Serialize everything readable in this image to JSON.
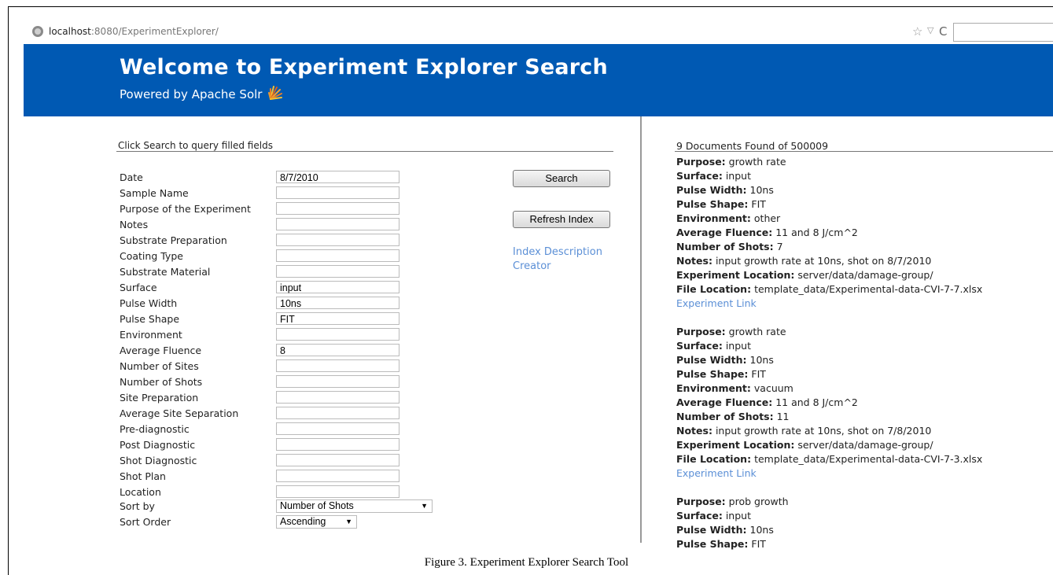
{
  "browser": {
    "url_host": "localhost",
    "url_rest": ":8080/ExperimentExplorer/"
  },
  "header": {
    "title": "Welcome to Experiment Explorer Search",
    "subtitle": "Powered by Apache Solr",
    "bg_color": "#0059b3"
  },
  "form": {
    "hint": "Click Search to query filled fields",
    "fields": [
      {
        "label": "Date",
        "value": "8/7/2010"
      },
      {
        "label": "Sample Name",
        "value": ""
      },
      {
        "label": "Purpose of the Experiment",
        "value": ""
      },
      {
        "label": "Notes",
        "value": ""
      },
      {
        "label": "Substrate Preparation",
        "value": ""
      },
      {
        "label": "Coating Type",
        "value": ""
      },
      {
        "label": "Substrate Material",
        "value": ""
      },
      {
        "label": "Surface",
        "value": "input"
      },
      {
        "label": "Pulse Width",
        "value": "10ns"
      },
      {
        "label": "Pulse Shape",
        "value": "FIT"
      },
      {
        "label": "Environment",
        "value": ""
      },
      {
        "label": "Average Fluence",
        "value": "8"
      },
      {
        "label": "Number of Sites",
        "value": ""
      },
      {
        "label": "Number of Shots",
        "value": ""
      },
      {
        "label": "Site Preparation",
        "value": ""
      },
      {
        "label": "Average Site Separation",
        "value": ""
      },
      {
        "label": "Pre-diagnostic",
        "value": ""
      },
      {
        "label": "Post Diagnostic",
        "value": ""
      },
      {
        "label": "Shot Diagnostic",
        "value": ""
      },
      {
        "label": "Shot Plan",
        "value": ""
      },
      {
        "label": "Location",
        "value": ""
      }
    ],
    "sort_by_label": "Sort by",
    "sort_by_value": "Number of Shots",
    "sort_order_label": "Sort Order",
    "sort_order_value": "Ascending",
    "search_button": "Search",
    "refresh_button": "Refresh Index",
    "index_link_1": "Index Description",
    "index_link_2": "Creator"
  },
  "results": {
    "summary": "9 Documents Found of 500009",
    "link_label": "Experiment Link",
    "docs": [
      {
        "lines": [
          {
            "k": "Purpose:",
            "v": "growth rate"
          },
          {
            "k": "Surface:",
            "v": "input"
          },
          {
            "k": "Pulse Width:",
            "v": "10ns"
          },
          {
            "k": "Pulse Shape:",
            "v": "FIT"
          },
          {
            "k": "Environment:",
            "v": "other"
          },
          {
            "k": "Average Fluence:",
            "v": "11 and 8 J/cm^2"
          },
          {
            "k": "Number of Shots:",
            "v": "7"
          },
          {
            "k": "Notes:",
            "v": "input growth rate at 10ns, shot on 8/7/2010"
          },
          {
            "k": "Experiment Location:",
            "v": "server/data/damage-group/"
          },
          {
            "k": "File Location:",
            "v": "template_data/Experimental-data-CVI-7-7.xlsx"
          }
        ]
      },
      {
        "lines": [
          {
            "k": "Purpose:",
            "v": "growth rate"
          },
          {
            "k": "Surface:",
            "v": "input"
          },
          {
            "k": "Pulse Width:",
            "v": "10ns"
          },
          {
            "k": "Pulse Shape:",
            "v": "FIT"
          },
          {
            "k": "Environment:",
            "v": "vacuum"
          },
          {
            "k": "Average Fluence:",
            "v": "11 and 8 J/cm^2"
          },
          {
            "k": "Number of Shots:",
            "v": "11"
          },
          {
            "k": "Notes:",
            "v": "input growth rate at 10ns, shot on 7/8/2010"
          },
          {
            "k": "Experiment Location:",
            "v": "server/data/damage-group/"
          },
          {
            "k": "File Location:",
            "v": "template_data/Experimental-data-CVI-7-3.xlsx"
          }
        ]
      },
      {
        "lines": [
          {
            "k": "Purpose:",
            "v": "prob growth"
          },
          {
            "k": "Surface:",
            "v": "input"
          },
          {
            "k": "Pulse Width:",
            "v": "10ns"
          },
          {
            "k": "Pulse Shape:",
            "v": "FIT"
          }
        ]
      }
    ]
  },
  "caption": "Figure 3.    Experiment Explorer Search Tool"
}
